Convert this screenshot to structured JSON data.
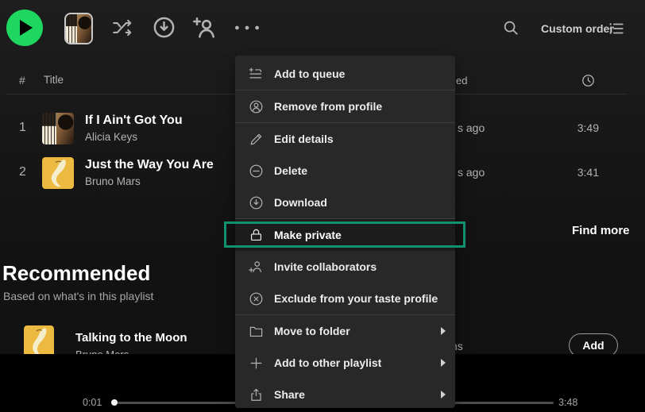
{
  "toolbar": {
    "custom_order_label": "Custom order"
  },
  "table": {
    "col_number": "#",
    "col_title": "Title",
    "col_added_fragment": "ed",
    "rows": [
      {
        "number": "1",
        "title": "If I Ain't Got You",
        "artist": "Alicia Keys",
        "added_fragment": "s ago",
        "duration": "3:49"
      },
      {
        "number": "2",
        "title": "Just the Way You Are",
        "artist": "Bruno Mars",
        "added_fragment": "s ago",
        "duration": "3:41"
      }
    ],
    "find_more_label": "Find more"
  },
  "context_menu": {
    "items": [
      {
        "label": "Add to queue",
        "icon": "add-to-queue-icon"
      },
      {
        "label": "Remove from profile",
        "icon": "remove-from-profile-icon"
      },
      {
        "label": "Edit details",
        "icon": "edit-details-icon"
      },
      {
        "label": "Delete",
        "icon": "delete-icon"
      },
      {
        "label": "Download",
        "icon": "download-icon"
      },
      {
        "label": "Make private",
        "icon": "lock-icon",
        "highlighted": true
      },
      {
        "label": "Invite collaborators",
        "icon": "invite-collaborators-icon"
      },
      {
        "label": "Exclude from your taste profile",
        "icon": "exclude-icon"
      },
      {
        "label": "Move to folder",
        "icon": "folder-icon",
        "has_submenu": true
      },
      {
        "label": "Add to other playlist",
        "icon": "plus-icon",
        "has_submenu": true
      },
      {
        "label": "Share",
        "icon": "share-icon",
        "has_submenu": true
      }
    ]
  },
  "recommended": {
    "heading": "Recommended",
    "subheading": "Based on what's in this playlist",
    "rows": [
      {
        "title": "Talking to the Moon",
        "artist": "Bruno Mars",
        "album_fragment": "ns",
        "add_button_label": "Add"
      }
    ]
  },
  "player": {
    "elapsed": "0:01",
    "total": "3:48"
  },
  "colors": {
    "accent_green": "#1ed760",
    "annotation_highlight": "#10926e",
    "menu_background": "#282828"
  }
}
